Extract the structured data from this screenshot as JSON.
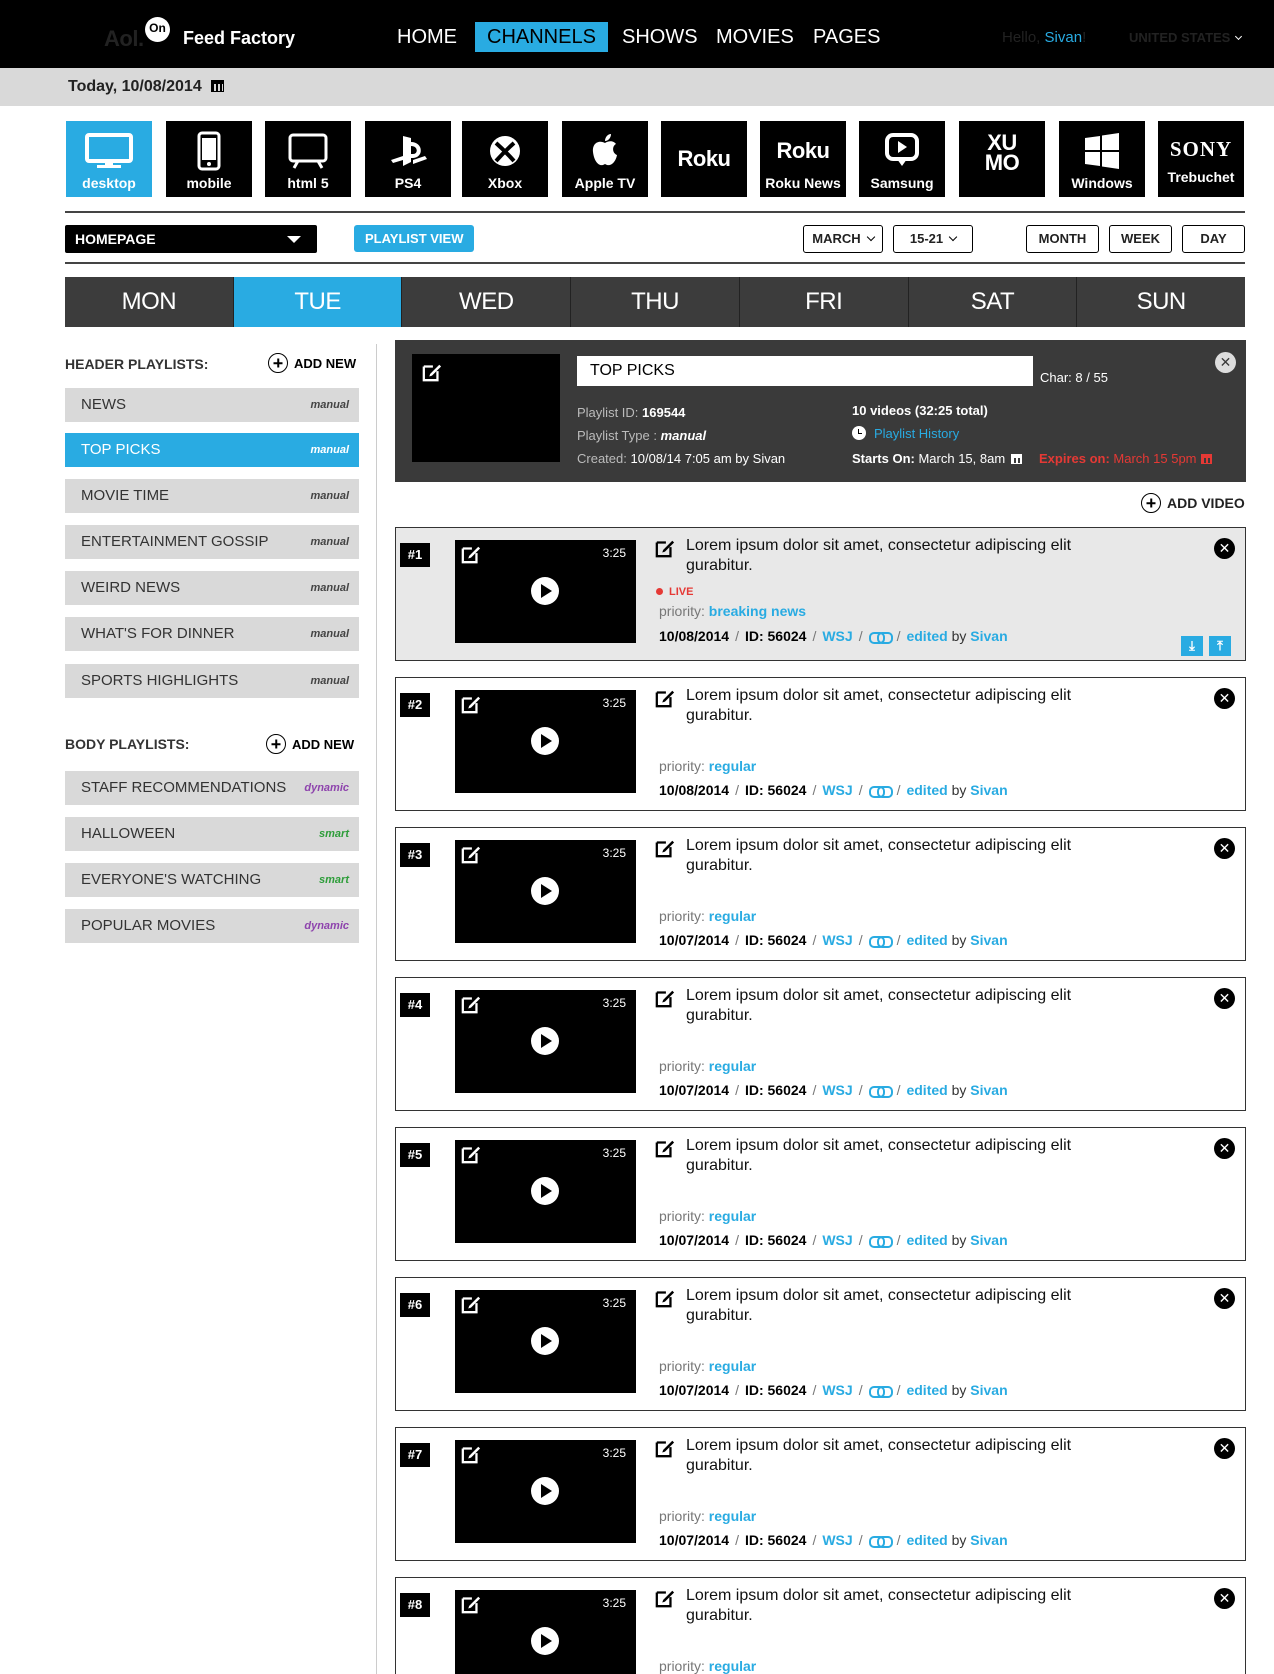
{
  "header": {
    "logo": "Aol.",
    "logo_badge": "On",
    "app_name": "Feed Factory",
    "nav": [
      "HOME",
      "CHANNELS",
      "SHOWS",
      "MOVIES",
      "PAGES"
    ],
    "active_nav": "CHANNELS",
    "greeting": "Hello, ",
    "user": "Sivan",
    "greeting_end": "!",
    "country": "UNITED STATES"
  },
  "today": "Today, 10/08/2014",
  "platforms": [
    {
      "label": "desktop",
      "icon": "monitor-icon"
    },
    {
      "label": "mobile",
      "icon": "phone-icon"
    },
    {
      "label": "html 5",
      "icon": "tv-icon"
    },
    {
      "label": "PS4",
      "icon": "playstation-icon"
    },
    {
      "label": "Xbox",
      "icon": "xbox-icon"
    },
    {
      "label": "Apple TV",
      "icon": "apple-icon"
    },
    {
      "label": "",
      "icon": "roku-logo",
      "wordmark": "Roku"
    },
    {
      "label": "Roku News",
      "icon": "roku-logo",
      "wordmark": "Roku"
    },
    {
      "label": "Samsung",
      "icon": "samsung-icon"
    },
    {
      "label": "",
      "icon": "xumo-logo",
      "wordmark": "XU MO"
    },
    {
      "label": "Windows",
      "icon": "windows-icon"
    },
    {
      "label": "Trebuchet",
      "icon": "sony-logo",
      "wordmark": "SONY"
    }
  ],
  "active_platform": "desktop",
  "toolbar": {
    "page_select": "HOMEPAGE",
    "playlist_view": "PLAYLIST VIEW",
    "month_select": "MARCH",
    "week_select": "15-21",
    "ranges": [
      "MONTH",
      "WEEK",
      "DAY"
    ]
  },
  "weekdays": [
    "MON",
    "TUE",
    "WED",
    "THU",
    "FRI",
    "SAT",
    "SUN"
  ],
  "active_day": "TUE",
  "sidebar": {
    "header_title": "HEADER PLAYLISTS:",
    "body_title": "BODY PLAYLISTS:",
    "add_new": "ADD NEW",
    "header_playlists": [
      {
        "name": "NEWS",
        "type": "manual"
      },
      {
        "name": "TOP PICKS",
        "type": "manual",
        "active": true
      },
      {
        "name": "MOVIE TIME",
        "type": "manual"
      },
      {
        "name": "ENTERTAINMENT GOSSIP",
        "type": "manual"
      },
      {
        "name": "WEIRD NEWS",
        "type": "manual"
      },
      {
        "name": "WHAT'S FOR DINNER",
        "type": "manual"
      },
      {
        "name": "SPORTS HIGHLIGHTS",
        "type": "manual"
      }
    ],
    "body_playlists": [
      {
        "name": "STAFF RECOMMENDATIONS",
        "type": "dynamic"
      },
      {
        "name": "HALLOWEEN",
        "type": "smart"
      },
      {
        "name": "EVERYONE'S WATCHING",
        "type": "smart"
      },
      {
        "name": "POPULAR MOVIES",
        "type": "dynamic"
      }
    ]
  },
  "playlist": {
    "title": "TOP PICKS",
    "char_count": "Char: 8 / 55",
    "id_label": "Playlist ID:",
    "id": "169544",
    "type_label": "Playlist Type :",
    "type": "manual",
    "created_label": "Created:",
    "created": "10/08/14 7:05 am by Sivan",
    "videos": "10 videos",
    "total": "(32:25 total)",
    "history": "Playlist History",
    "starts_label": "Starts On:",
    "starts": "March 15, 8am",
    "expires_label": "Expires on:",
    "expires": "March 15 5pm",
    "add_video": "ADD VIDEO"
  },
  "videos": [
    {
      "num": "#1",
      "duration": "3:25",
      "title": "Lorem ipsum dolor sit amet, consectetur adipiscing elit gurabitur.",
      "live": "LIVE",
      "priority_label": "priority:",
      "priority": "breaking news",
      "date": "10/08/2014",
      "id": "ID: 56024",
      "source": "WSJ",
      "edited": "edited",
      "by": "by",
      "editor": "Sivan"
    },
    {
      "num": "#2",
      "duration": "3:25",
      "title": "Lorem ipsum dolor sit amet, consectetur adipiscing elit gurabitur.",
      "priority_label": "priority:",
      "priority": "regular",
      "date": "10/08/2014",
      "id": "ID: 56024",
      "source": "WSJ",
      "edited": "edited",
      "by": "by",
      "editor": "Sivan"
    },
    {
      "num": "#3",
      "duration": "3:25",
      "title": "Lorem ipsum dolor sit amet, consectetur adipiscing elit gurabitur.",
      "priority_label": "priority:",
      "priority": "regular",
      "date": "10/07/2014",
      "id": "ID: 56024",
      "source": "WSJ",
      "edited": "edited",
      "by": "by",
      "editor": "Sivan"
    },
    {
      "num": "#4",
      "duration": "3:25",
      "title": "Lorem ipsum dolor sit amet, consectetur adipiscing elit gurabitur.",
      "priority_label": "priority:",
      "priority": "regular",
      "date": "10/07/2014",
      "id": "ID: 56024",
      "source": "WSJ",
      "edited": "edited",
      "by": "by",
      "editor": "Sivan"
    },
    {
      "num": "#5",
      "duration": "3:25",
      "title": "Lorem ipsum dolor sit amet, consectetur adipiscing elit gurabitur.",
      "priority_label": "priority:",
      "priority": "regular",
      "date": "10/07/2014",
      "id": "ID: 56024",
      "source": "WSJ",
      "edited": "edited",
      "by": "by",
      "editor": "Sivan"
    },
    {
      "num": "#6",
      "duration": "3:25",
      "title": "Lorem ipsum dolor sit amet, consectetur adipiscing elit gurabitur.",
      "priority_label": "priority:",
      "priority": "regular",
      "date": "10/07/2014",
      "id": "ID: 56024",
      "source": "WSJ",
      "edited": "edited",
      "by": "by",
      "editor": "Sivan"
    },
    {
      "num": "#7",
      "duration": "3:25",
      "title": "Lorem ipsum dolor sit amet, consectetur adipiscing elit gurabitur.",
      "priority_label": "priority:",
      "priority": "regular",
      "date": "10/07/2014",
      "id": "ID: 56024",
      "source": "WSJ",
      "edited": "edited",
      "by": "by",
      "editor": "Sivan"
    },
    {
      "num": "#8",
      "duration": "3:25",
      "title": "Lorem ipsum dolor sit amet, consectetur adipiscing elit gurabitur.",
      "priority_label": "priority:",
      "priority": "regular"
    }
  ],
  "colors": {
    "accent": "#29abe2",
    "live": "#e53935",
    "dynamic": "#8e44ad",
    "smart": "#2e9d3a"
  }
}
